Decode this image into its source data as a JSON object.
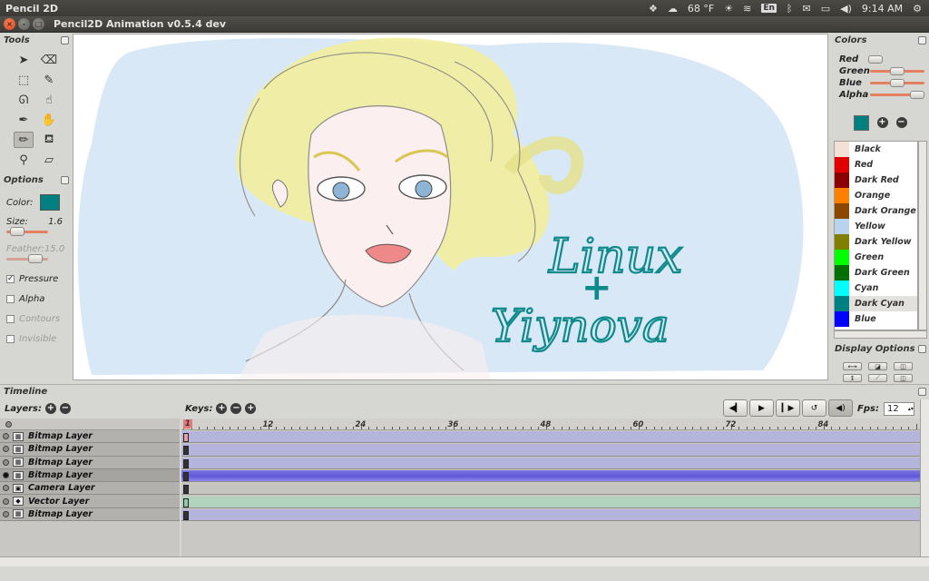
{
  "topbar": {
    "app_name": "Pencil 2D",
    "weather": "68 °F",
    "keyboard": "En",
    "time": "9:14 AM"
  },
  "window": {
    "title": "Pencil2D Animation v0.5.4 dev"
  },
  "tools": {
    "title": "Tools",
    "items": [
      "pointer",
      "clear",
      "select",
      "brush",
      "lasso",
      "smudge",
      "pen",
      "hand",
      "pencil",
      "bucket",
      "eyedropper",
      "eraser"
    ],
    "active": "pencil"
  },
  "options": {
    "title": "Options",
    "color_label": "Color:",
    "color": "#008080",
    "size_label": "Size:",
    "size_value": "1.6",
    "feather_label": "Feather:",
    "feather_value": "15.0",
    "pressure_label": "Pressure",
    "pressure_checked": true,
    "alpha_label": "Alpha",
    "contours_label": "Contours",
    "invisible_label": "Invisible"
  },
  "canvas": {
    "text_line1": "Linux",
    "text_line2": "+",
    "text_line3": "Yiynova"
  },
  "colors_panel": {
    "title": "Colors",
    "red_label": "Red",
    "green_label": "Green",
    "blue_label": "Blue",
    "alpha_label": "Alpha",
    "current": "#008080",
    "palette": [
      {
        "name": "Black",
        "hex": "#f4e0d6"
      },
      {
        "name": "Red",
        "hex": "#e10000"
      },
      {
        "name": "Dark Red",
        "hex": "#8a0000"
      },
      {
        "name": "Orange",
        "hex": "#ff8000"
      },
      {
        "name": "Dark Orange",
        "hex": "#8a4700"
      },
      {
        "name": "Yellow",
        "hex": "#b9d3ef"
      },
      {
        "name": "Dark Yellow",
        "hex": "#808000"
      },
      {
        "name": "Green",
        "hex": "#00ff00"
      },
      {
        "name": "Dark Green",
        "hex": "#007000"
      },
      {
        "name": "Cyan",
        "hex": "#00ffff"
      },
      {
        "name": "Dark Cyan",
        "hex": "#008080"
      },
      {
        "name": "Blue",
        "hex": "#0000ff"
      }
    ],
    "selected": "Dark Cyan"
  },
  "display_options": {
    "title": "Display Options"
  },
  "timeline": {
    "title": "Timeline",
    "layers_label": "Layers:",
    "keys_label": "Keys:",
    "fps_label": "Fps:",
    "fps_value": "12",
    "ruler_labels": [
      "1",
      "12",
      "24",
      "36",
      "48",
      "60",
      "72",
      "84"
    ],
    "layers": [
      {
        "name": "Bitmap Layer",
        "type": "bitmap"
      },
      {
        "name": "Bitmap Layer",
        "type": "bitmap"
      },
      {
        "name": "Bitmap Layer",
        "type": "bitmap"
      },
      {
        "name": "Bitmap Layer",
        "type": "bitmap",
        "selected": true
      },
      {
        "name": "Camera Layer",
        "type": "camera"
      },
      {
        "name": "Vector Layer",
        "type": "vector"
      },
      {
        "name": "Bitmap Layer",
        "type": "bitmap"
      }
    ]
  }
}
